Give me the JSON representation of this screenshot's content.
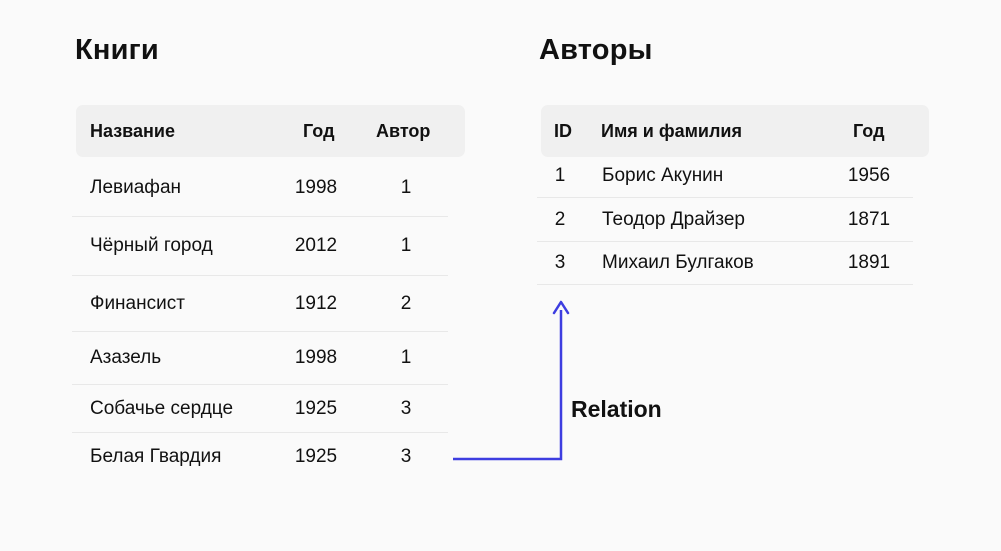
{
  "books": {
    "title": "Книги",
    "headers": [
      "Название",
      "Год",
      "Автор"
    ],
    "rows": [
      [
        "Левиафан",
        "1998",
        "1"
      ],
      [
        "Чёрный город",
        "2012",
        "1"
      ],
      [
        "Финансист",
        "1912",
        "2"
      ],
      [
        "Азазель",
        "1998",
        "1"
      ],
      [
        "Собачье сердце",
        "1925",
        "3"
      ],
      [
        "Белая Гвардия",
        "1925",
        "3"
      ]
    ]
  },
  "authors": {
    "title": "Авторы",
    "headers": [
      "ID",
      "Имя и фамилия",
      "Год"
    ],
    "rows": [
      [
        "1",
        "Борис Акунин",
        "1956"
      ],
      [
        "2",
        "Теодор Драйзер",
        "1871"
      ],
      [
        "3",
        "Михаил Булгаков",
        "1891"
      ]
    ]
  },
  "relation": {
    "label": "Relation",
    "color": "#3d3de0"
  }
}
